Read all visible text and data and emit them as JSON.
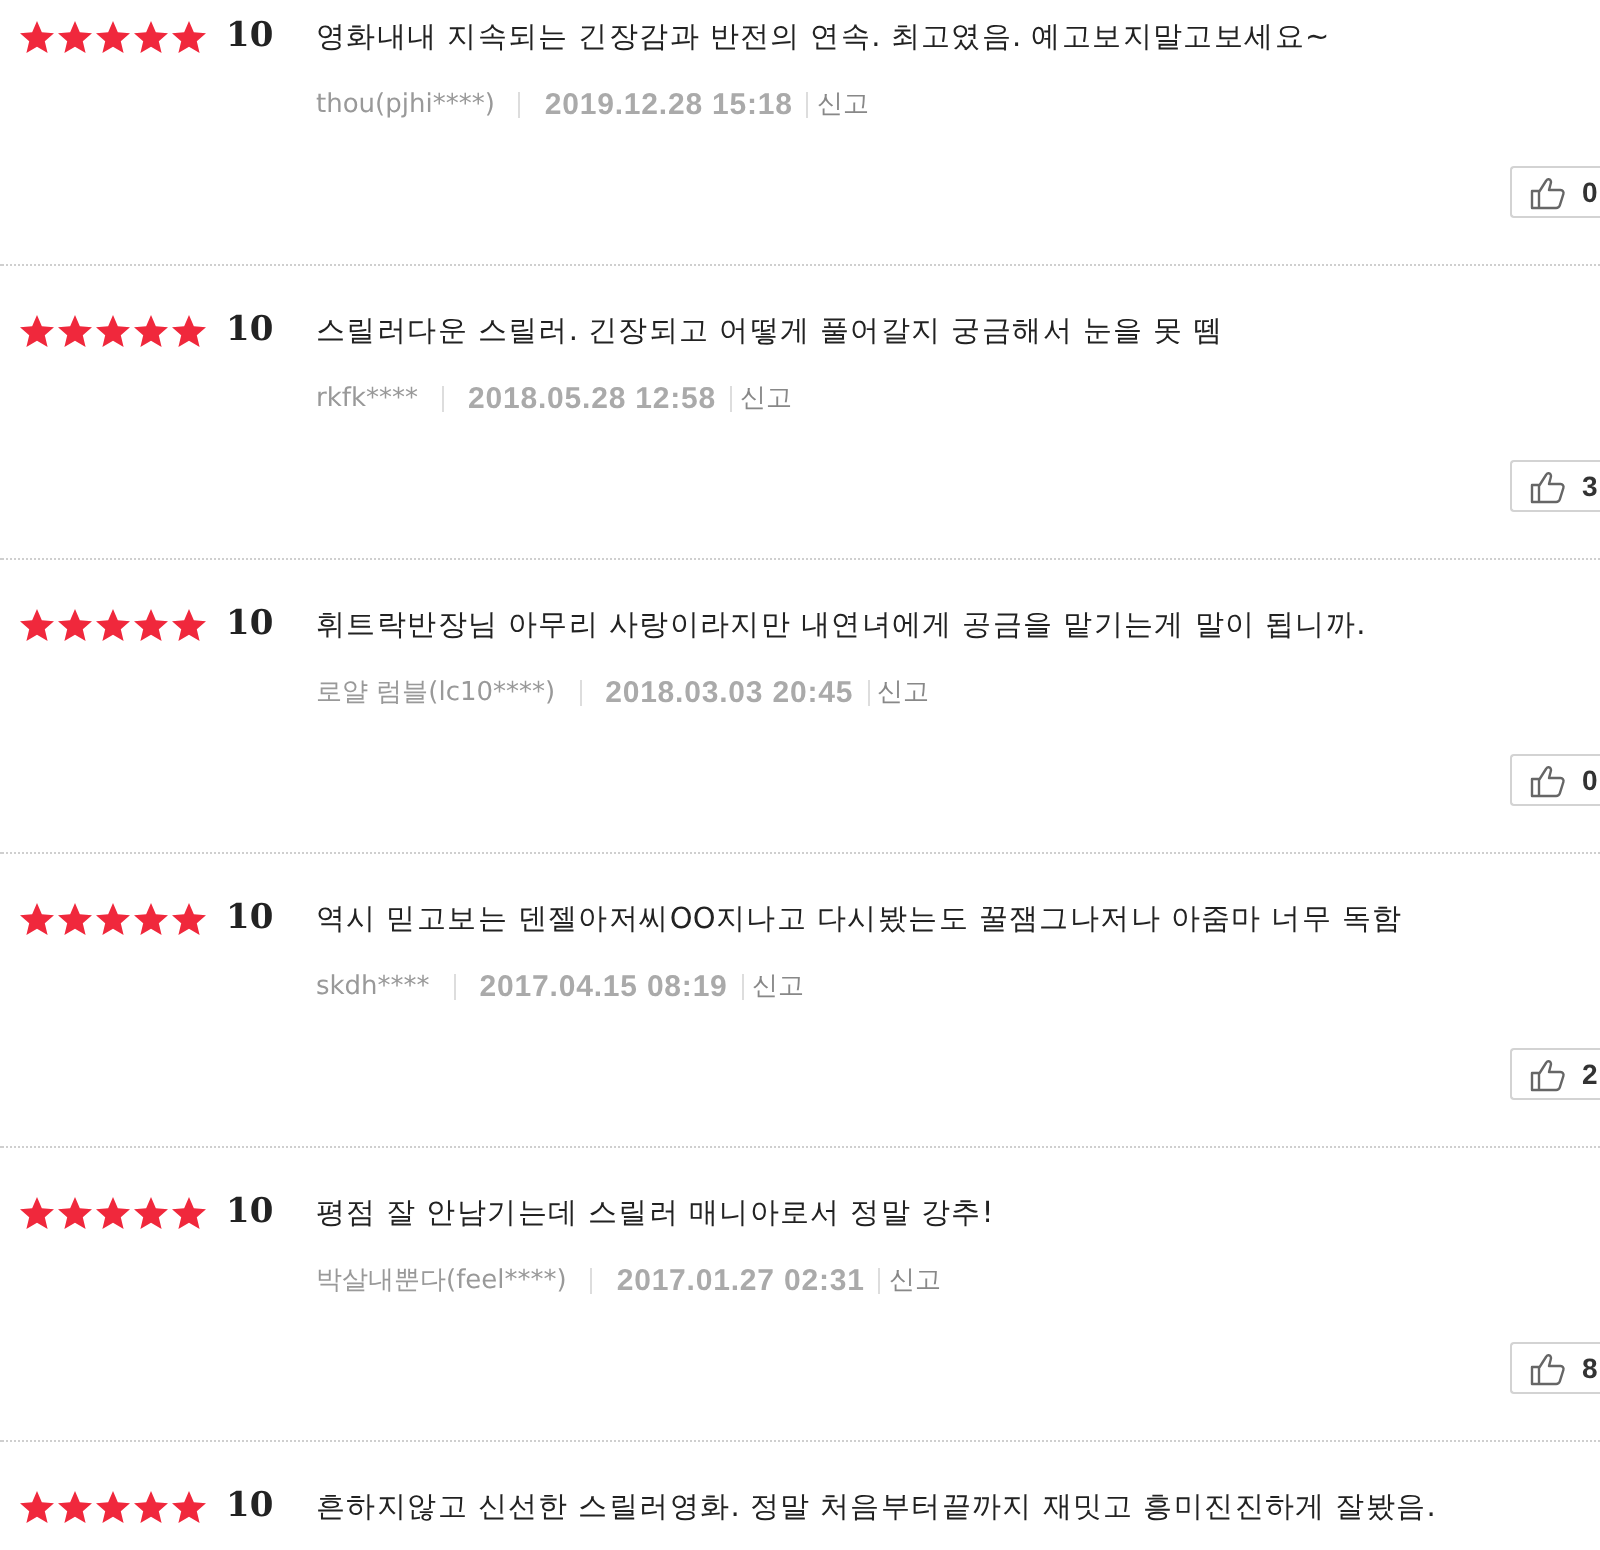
{
  "reviews": [
    {
      "stars": 5,
      "score": "10",
      "comment": "영화내내 지속되는 긴장감과 반전의 연속. 최고였음. 예고보지말고보세요~",
      "author": "thou(pjhi****)",
      "date": "2019.12.28 15:18",
      "report": "신고",
      "likes": "0"
    },
    {
      "stars": 5,
      "score": "10",
      "comment": "스릴러다운 스릴러. 긴장되고 어떻게 풀어갈지 궁금해서 눈을 못 뗌",
      "author": "rkfk****",
      "date": "2018.05.28 12:58",
      "report": "신고",
      "likes": "3"
    },
    {
      "stars": 5,
      "score": "10",
      "comment": "휘트락반장님 아무리 사랑이라지만 내연녀에게 공금을 맡기는게 말이 됩니까.",
      "author": "로얄 럼블(lc10****)",
      "date": "2018.03.03 20:45",
      "report": "신고",
      "likes": "0"
    },
    {
      "stars": 5,
      "score": "10",
      "comment": "역시 믿고보는 덴젤아저씨OO지나고 다시봤는도 꿀잼그나저나 아줌마 너무 독함",
      "author": "skdh****",
      "date": "2017.04.15 08:19",
      "report": "신고",
      "likes": "2"
    },
    {
      "stars": 5,
      "score": "10",
      "comment": "평점 잘 안남기는데 스릴러 매니아로서 정말 강추!",
      "author": "박살내뿐다(feel****)",
      "date": "2017.01.27 02:31",
      "report": "신고",
      "likes": "8"
    },
    {
      "stars": 5,
      "score": "10",
      "comment": "흔하지않고 신선한 스릴러영화. 정말 처음부터끝까지 재밋고 흥미진진하게 잘봤음."
    }
  ]
}
